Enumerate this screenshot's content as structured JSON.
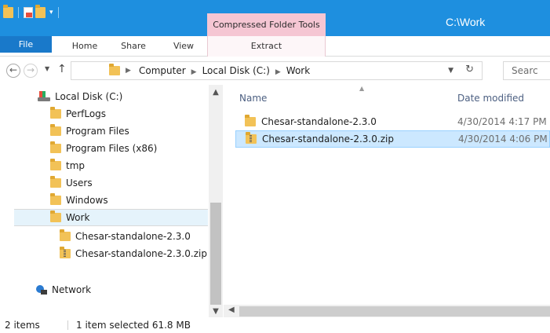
{
  "window": {
    "title": "C:\\Work",
    "context_tab_header": "Compressed Folder Tools",
    "accent_color": "#1e8fdf"
  },
  "ribbon": {
    "tabs": [
      {
        "label": "File"
      },
      {
        "label": "Home"
      },
      {
        "label": "Share"
      },
      {
        "label": "View"
      },
      {
        "label": "Extract"
      }
    ]
  },
  "address": {
    "breadcrumbs": [
      "Computer",
      "Local Disk (C:)",
      "Work"
    ],
    "search_placeholder": "Searc"
  },
  "nav_pane": {
    "items": [
      {
        "label": "Local Disk (C:)",
        "icon": "drive-icon"
      },
      {
        "label": "PerfLogs",
        "icon": "folder-icon"
      },
      {
        "label": "Program Files",
        "icon": "folder-icon"
      },
      {
        "label": "Program Files (x86)",
        "icon": "folder-icon"
      },
      {
        "label": "tmp",
        "icon": "folder-icon"
      },
      {
        "label": "Users",
        "icon": "folder-icon"
      },
      {
        "label": "Windows",
        "icon": "folder-icon"
      },
      {
        "label": "Work",
        "icon": "folder-icon",
        "selected": true
      },
      {
        "label": "Chesar-standalone-2.3.0",
        "icon": "folder-icon"
      },
      {
        "label": "Chesar-standalone-2.3.0.zip",
        "icon": "zip-folder-icon"
      },
      {
        "label": "Network",
        "icon": "network-icon"
      }
    ]
  },
  "content": {
    "columns": {
      "name": "Name",
      "date": "Date modified"
    },
    "rows": [
      {
        "name": "Chesar-standalone-2.3.0",
        "date": "4/30/2014 4:17 PM",
        "icon": "folder-icon",
        "selected": false
      },
      {
        "name": "Chesar-standalone-2.3.0.zip",
        "date": "4/30/2014 4:06 PM",
        "icon": "zip-folder-icon",
        "selected": true
      }
    ]
  },
  "status": {
    "count": "2 items",
    "selection": "1 item selected  61.8 MB"
  }
}
